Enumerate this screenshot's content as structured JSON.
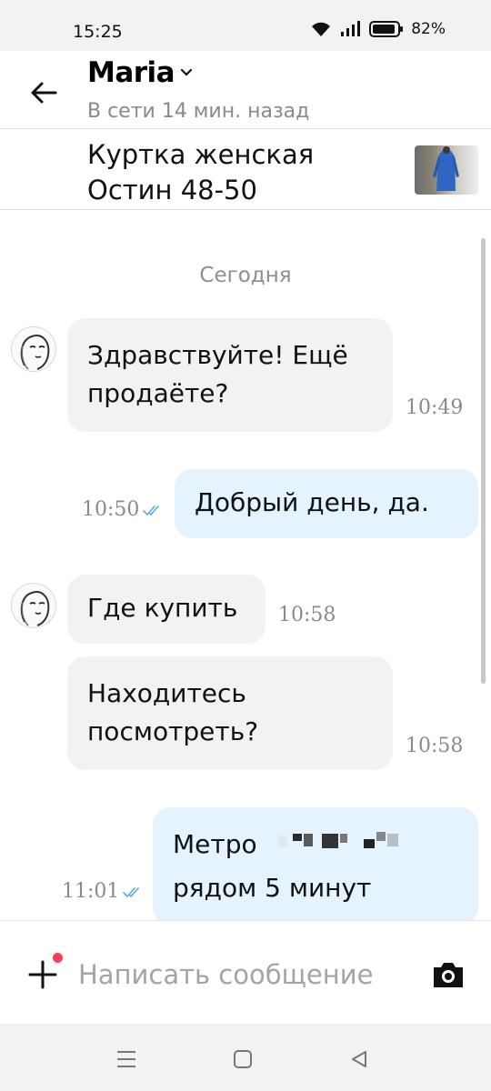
{
  "status_bar": {
    "time": "15:25",
    "battery": "82%"
  },
  "header": {
    "name": "Maria",
    "presence": "В сети 14 мин. назад"
  },
  "product": {
    "title": "Куртка женская Остин 48-50"
  },
  "chat": {
    "date_separator": "Сегодня",
    "messages": [
      {
        "text": "Здравствуйте! Ещё продаёте?",
        "time": "10:49",
        "direction": "in"
      },
      {
        "text": "Добрый день, да.",
        "time": "10:50",
        "direction": "out"
      },
      {
        "text": "Где купить",
        "time": "10:58",
        "direction": "in"
      },
      {
        "text": "Находитесь посмотреть?",
        "time": "10:58",
        "direction": "in"
      },
      {
        "text_line1": "Метро",
        "text_line2": "рядом 5 минут",
        "time": "11:01",
        "direction": "out"
      }
    ]
  },
  "composer": {
    "placeholder": "Написать сообщение"
  },
  "colors": {
    "incoming_bubble": "#f2f2f2",
    "outgoing_bubble": "#e4f3fd",
    "notification_dot": "#ff3b55",
    "read_ticks": "#5aa9e6"
  }
}
